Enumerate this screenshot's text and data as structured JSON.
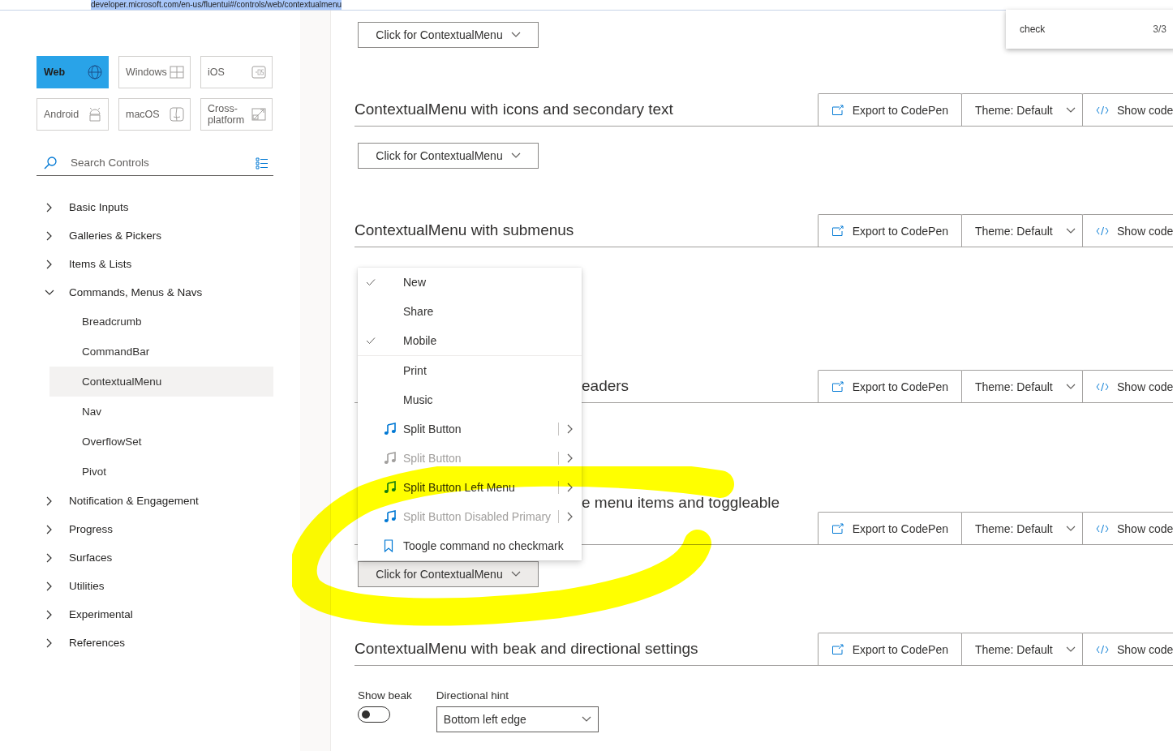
{
  "address_bar": {
    "url": "developer.microsoft.com/en-us/fluentui#/controls/web/contextualmenu"
  },
  "find_bar": {
    "query": "check",
    "count": "3/3"
  },
  "sidebar": {
    "platforms": [
      {
        "label": "Web",
        "selected": true
      },
      {
        "label": "Windows",
        "selected": false
      },
      {
        "label": "iOS",
        "selected": false
      },
      {
        "label": "Android",
        "selected": false
      },
      {
        "label": "macOS",
        "selected": false
      },
      {
        "label": "Cross-platform",
        "selected": false
      }
    ],
    "search": {
      "placeholder": "Search Controls"
    },
    "nav": [
      {
        "label": "Basic Inputs",
        "expanded": false
      },
      {
        "label": "Galleries & Pickers",
        "expanded": false
      },
      {
        "label": "Items & Lists",
        "expanded": false
      },
      {
        "label": "Commands, Menus & Navs",
        "expanded": true,
        "children": [
          {
            "label": "Breadcrumb",
            "selected": false
          },
          {
            "label": "CommandBar",
            "selected": false
          },
          {
            "label": "ContextualMenu",
            "selected": true
          },
          {
            "label": "Nav",
            "selected": false
          },
          {
            "label": "OverflowSet",
            "selected": false
          },
          {
            "label": "Pivot",
            "selected": false
          }
        ]
      },
      {
        "label": "Notification & Engagement",
        "expanded": false
      },
      {
        "label": "Progress",
        "expanded": false
      },
      {
        "label": "Surfaces",
        "expanded": false
      },
      {
        "label": "Utilities",
        "expanded": false
      },
      {
        "label": "Experimental",
        "expanded": false
      },
      {
        "label": "References",
        "expanded": false
      }
    ]
  },
  "content": [
    {
      "kind": "button",
      "label": "Click for ContextualMenu",
      "pressed": false
    },
    {
      "kind": "header",
      "title": "ContextualMenu with icons and secondary text",
      "toolbar": {
        "export": "Export to CodePen",
        "theme": "Theme: Default",
        "code": "Show code"
      }
    },
    {
      "kind": "button",
      "label": "Click for ContextualMenu",
      "pressed": false
    },
    {
      "kind": "header",
      "title": "ContextualMenu with submenus",
      "toolbar": {
        "export": "Export to CodePen",
        "theme": "Theme: Default",
        "code": "Show code"
      }
    },
    {
      "kind": "header",
      "title_end": "eaders",
      "toolbar": {
        "export": "Export to CodePen",
        "theme": "Theme: Default",
        "code": "Show code"
      }
    },
    {
      "kind": "header_low",
      "title_end": "e menu items and toggleable",
      "toolbar": {
        "export": "Export to CodePen",
        "theme": "Theme: Default",
        "code": "Show code"
      }
    },
    {
      "kind": "button",
      "label": "Click for ContextualMenu",
      "pressed": true
    },
    {
      "kind": "header",
      "title": "ContextualMenu with beak and directional settings",
      "toolbar": {
        "export": "Export to CodePen",
        "theme": "Theme: Default",
        "code": "Show code"
      }
    },
    {
      "kind": "settings",
      "beak_label": "Show beak",
      "beak_on": false,
      "hint_label": "Directional hint",
      "hint_value": "Bottom left edge"
    }
  ],
  "menu": [
    {
      "kind": "check",
      "label": "New",
      "checked": true
    },
    {
      "kind": "check",
      "label": "Share",
      "checked": false
    },
    {
      "kind": "check",
      "label": "Mobile",
      "checked": true
    },
    {
      "kind": "divider"
    },
    {
      "kind": "plain",
      "label": "Print"
    },
    {
      "kind": "plain",
      "label": "Music"
    },
    {
      "kind": "split",
      "label": "Split Button",
      "color": "#0078d4",
      "disabled": false
    },
    {
      "kind": "split",
      "label": "Split Button",
      "color": "#a19f9d",
      "disabled": true
    },
    {
      "kind": "split",
      "label": "Split Button Left Menu",
      "color": "#107c10",
      "disabled": false
    },
    {
      "kind": "split",
      "label": "Split Button Disabled Primary",
      "color": "#0078d4",
      "disabled": true
    },
    {
      "kind": "bookmark",
      "label": "Toogle command no checkmark"
    }
  ]
}
